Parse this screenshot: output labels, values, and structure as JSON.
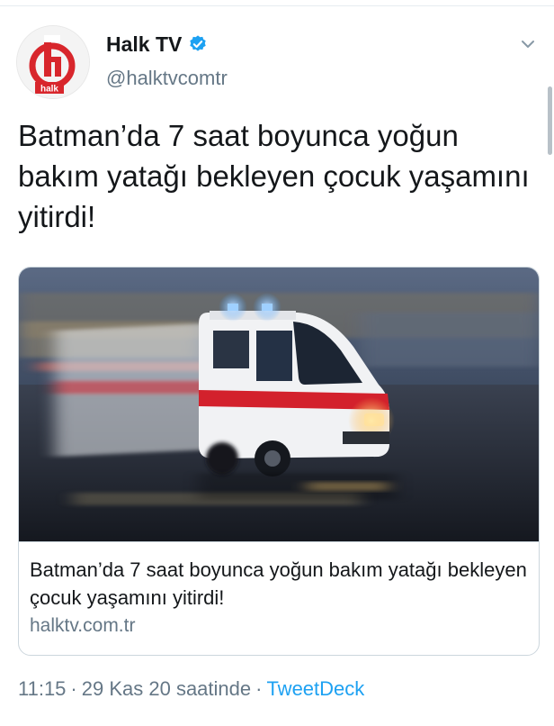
{
  "author": {
    "display_name": "Halk TV",
    "handle": "@halktvcomtr",
    "avatar_text": "halk",
    "verified": true,
    "avatar_color": "#d8262c"
  },
  "tweet": {
    "text": "Batman’da 7 saat boyunca yoğun bakım yatağı bekleyen çocuk yaşamını yitirdi!"
  },
  "card": {
    "title": "Batman’da 7 saat boyunca yoğun bakım yatağı bekleyen çocuk yaşamını yitirdi!",
    "domain": "halktv.com.tr",
    "image_subject": "ambulance-photo"
  },
  "meta": {
    "time": "11:15",
    "separator": "·",
    "date": "29 Kas 20 saatinde",
    "source": "TweetDeck"
  },
  "icons": {
    "verified": "verified-badge-icon",
    "more": "chevron-down-icon"
  },
  "colors": {
    "link": "#1da1f2",
    "secondary_text": "#657786",
    "verified": "#1da1f2"
  }
}
